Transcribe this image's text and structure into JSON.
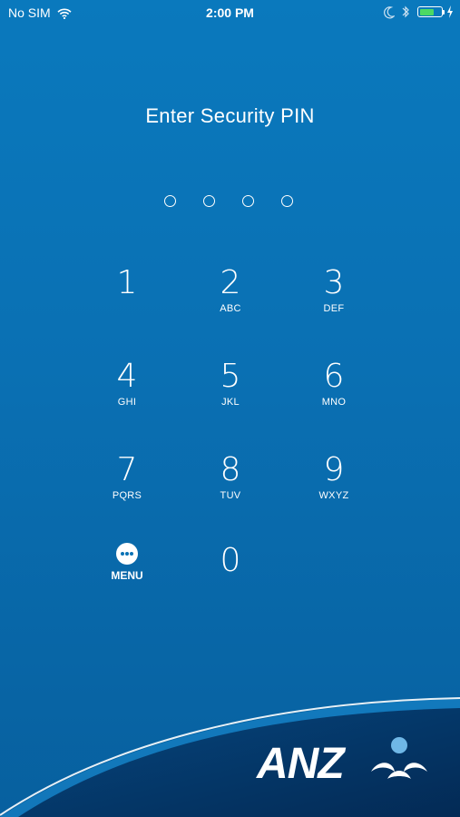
{
  "status_bar": {
    "carrier": "No SIM",
    "time": "2:00 PM",
    "battery_level": 0.7,
    "battery_color": "#4cd964",
    "icons": [
      "wifi-icon",
      "moon-icon",
      "bluetooth-icon",
      "battery-icon",
      "charging-bolt-icon"
    ]
  },
  "title": "Enter Security PIN",
  "pin": {
    "length": 4,
    "entered": 0
  },
  "keypad": {
    "keys": [
      {
        "digit": "1",
        "letters": ""
      },
      {
        "digit": "2",
        "letters": "ABC"
      },
      {
        "digit": "3",
        "letters": "DEF"
      },
      {
        "digit": "4",
        "letters": "GHI"
      },
      {
        "digit": "5",
        "letters": "JKL"
      },
      {
        "digit": "6",
        "letters": "MNO"
      },
      {
        "digit": "7",
        "letters": "PQRS"
      },
      {
        "digit": "8",
        "letters": "TUV"
      },
      {
        "digit": "9",
        "letters": "WXYZ"
      },
      {
        "digit": "0",
        "letters": ""
      }
    ],
    "menu_label": "MENU",
    "menu_icon": "ellipsis-icon"
  },
  "brand": {
    "logo_text": "ANZ",
    "logo_icon": "anz-people-icon",
    "accent": "#0a72b5"
  }
}
